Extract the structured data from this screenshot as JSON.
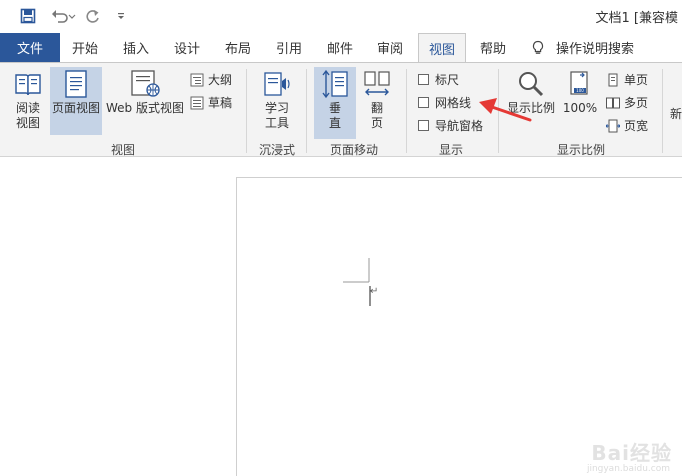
{
  "title_bar": {
    "document_title": "文档1 [兼容模",
    "qat": {
      "save_icon": "save-icon",
      "undo_icon": "undo-icon",
      "redo_icon": "redo-icon",
      "customize_icon": "customize-qat-icon"
    }
  },
  "tabs": {
    "file": "文件",
    "items": [
      "开始",
      "插入",
      "设计",
      "布局",
      "引用",
      "邮件",
      "审阅",
      "视图",
      "帮助"
    ],
    "active": "视图",
    "tell_me": "操作说明搜索"
  },
  "ribbon": {
    "groups": {
      "views": {
        "label": "视图",
        "read_mode": "阅读\n视图",
        "read_mode_line1": "阅读",
        "read_mode_line2": "视图",
        "print_layout": "页面视图",
        "web_layout": "Web 版式视图",
        "outline": "大纲",
        "draft": "草稿"
      },
      "immersive": {
        "label": "沉浸式",
        "learning_tools_line1": "学习",
        "learning_tools_line2": "工具"
      },
      "page_movement": {
        "label": "页面移动",
        "vertical": "垂",
        "vertical_line2": "直",
        "side_to_side": "翻",
        "side_to_side_line2": "页"
      },
      "show": {
        "label": "显示",
        "ruler": "标尺",
        "gridlines": "网格线",
        "nav_pane": "导航窗格",
        "ruler_checked": false,
        "gridlines_checked": false,
        "nav_pane_checked": false
      },
      "zoom": {
        "label": "显示比例",
        "zoom": "显示比例",
        "hundred": "100%",
        "one_page": "单页",
        "multiple_pages": "多页",
        "page_width": "页宽"
      },
      "partial": {
        "new_window": "新"
      }
    }
  },
  "document": {
    "caret_mark": "↵"
  },
  "watermark": {
    "text": "Bai经验",
    "sub": "jingyan.baidu.com"
  },
  "colors": {
    "file_tab": "#2b579a",
    "selected_button": "#c5d3e6",
    "ribbon_bg": "#f3f3f3",
    "annotation_arrow": "#e53935"
  }
}
